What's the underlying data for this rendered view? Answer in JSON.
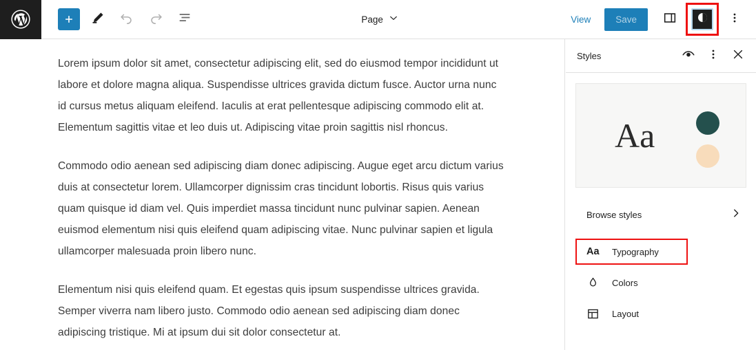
{
  "header": {
    "logo_icon": "wordpress-logo-icon",
    "tools": [
      {
        "name": "block-inserter",
        "icon": "plus-icon",
        "label": "Add block",
        "disabled": false
      },
      {
        "name": "edit-tool",
        "icon": "pencil-icon",
        "label": "Edit",
        "disabled": false
      },
      {
        "name": "undo",
        "icon": "undo-arrow-icon",
        "label": "Undo",
        "disabled": true
      },
      {
        "name": "redo",
        "icon": "redo-arrow-icon",
        "label": "Redo",
        "disabled": true
      },
      {
        "name": "list-view",
        "icon": "list-view-icon",
        "label": "Document overview",
        "disabled": false
      }
    ],
    "document_type": "Page",
    "document_type_icon": "chevron-down-icon",
    "view_label": "View",
    "save_label": "Save",
    "sidebar_toggle_icon": "panel-right-icon",
    "styles_toggle_icon": "contrast-half-circle-icon",
    "styles_toggle_active": true,
    "options_icon": "vertical-dots-icon",
    "accent_blue": "#1d7fb8",
    "logo_background": "#1e1e1e",
    "annotation_color": "#ee1111"
  },
  "canvas": {
    "paragraphs": [
      "Lorem ipsum dolor sit amet, consectetur adipiscing elit, sed do eiusmod tempor incididunt ut labore et dolore magna aliqua. Suspendisse ultrices gravida dictum fusce. Auctor urna nunc id cursus metus aliquam eleifend. Iaculis at erat pellentesque adipiscing commodo elit at. Elementum sagittis vitae et leo duis ut. Adipiscing vitae proin sagittis nisl rhoncus.",
      "Commodo odio aenean sed adipiscing diam donec adipiscing. Augue eget arcu dictum varius duis at consectetur lorem. Ullamcorper dignissim cras tincidunt lobortis. Risus quis varius quam quisque id diam vel. Quis imperdiet massa tincidunt nunc pulvinar sapien. Aenean euismod elementum nisi quis eleifend quam adipiscing vitae. Nunc pulvinar sapien et ligula ullamcorper malesuada proin libero nunc.",
      "Elementum nisi quis eleifend quam. Et egestas quis ipsum suspendisse ultrices gravida. Semper viverra nam libero justo. Commodo odio aenean sed adipiscing diam donec adipiscing tristique. Mi at ipsum dui sit dolor consectetur at."
    ],
    "text_color": "#3c3c3c"
  },
  "sidebar": {
    "title": "Styles",
    "header_actions": [
      {
        "name": "style-book",
        "icon": "eye-icon",
        "label": "Style Book"
      },
      {
        "name": "styles-options",
        "icon": "vertical-dots-icon",
        "label": "Styles actions"
      },
      {
        "name": "close-styles",
        "icon": "close-x-icon",
        "label": "Close Styles"
      }
    ],
    "preview": {
      "typeface_sample": "Aa",
      "swatch_primary": "#24504d",
      "swatch_secondary": "#f8dcbb",
      "card_background": "#f7f7f6"
    },
    "browse": {
      "label": "Browse styles",
      "icon": "chevron-right-icon"
    },
    "items": [
      {
        "label": "Typography",
        "icon": "aa-typography-icon",
        "highlighted": true
      },
      {
        "label": "Colors",
        "icon": "droplet-icon",
        "highlighted": false
      },
      {
        "label": "Layout",
        "icon": "layout-grid-icon",
        "highlighted": false
      }
    ]
  }
}
